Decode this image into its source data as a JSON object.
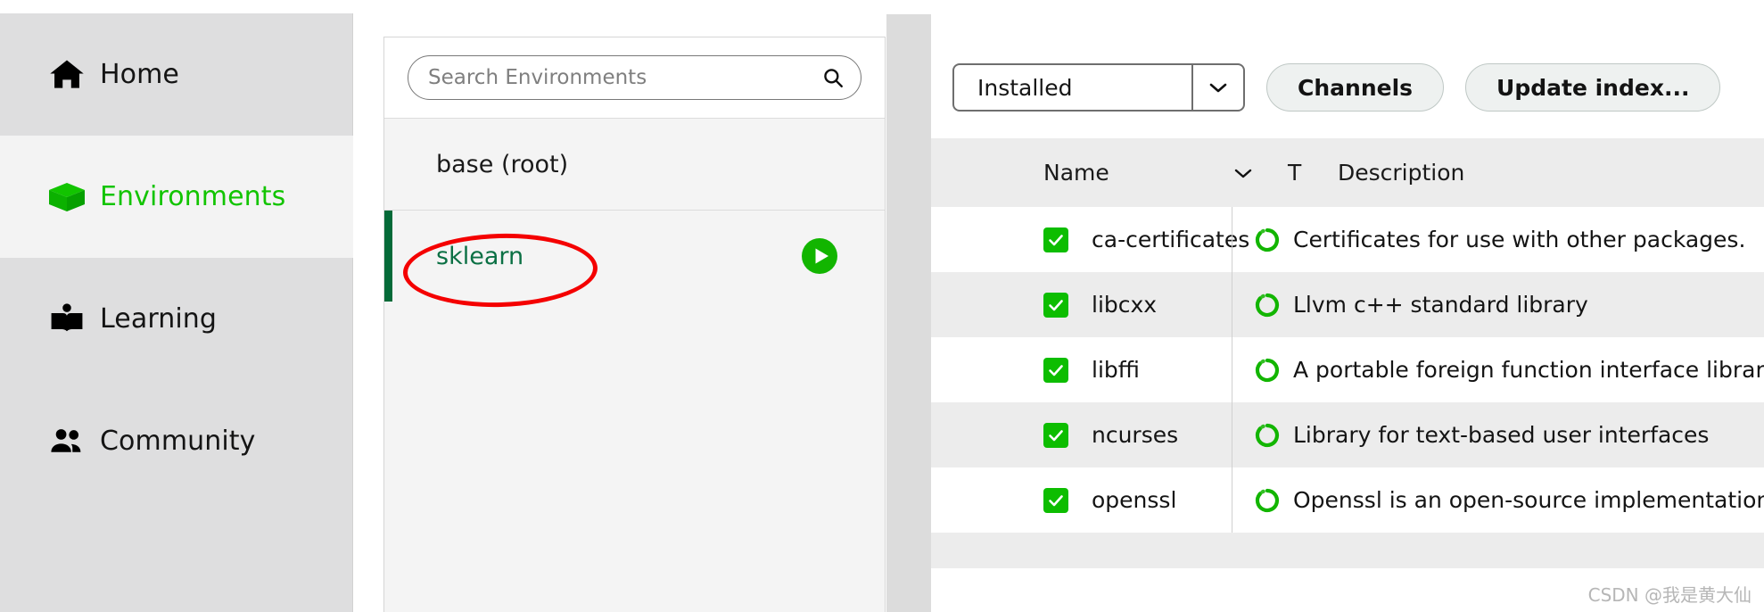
{
  "sidebar": {
    "items": [
      {
        "label": "Home",
        "icon": "home-icon",
        "active": false
      },
      {
        "label": "Environments",
        "icon": "box-icon",
        "active": true
      },
      {
        "label": "Learning",
        "icon": "book-icon",
        "active": false
      },
      {
        "label": "Community",
        "icon": "people-icon",
        "active": false
      }
    ],
    "accent_color": "#12c400",
    "background": "#dededf",
    "active_background": "#f3f3f3"
  },
  "environments": {
    "search": {
      "placeholder": "Search Environments",
      "value": "",
      "icon": "search-icon"
    },
    "rows": [
      {
        "name": "base (root)",
        "selected": false,
        "has_play": false
      },
      {
        "name": "sklearn",
        "selected": true,
        "has_play": true,
        "play_icon": "play-circle-icon"
      }
    ],
    "selected_accent": "#046a38",
    "selected_text_color": "#0b7044"
  },
  "annotation": {
    "type": "ellipse",
    "color": "#f40000",
    "targets": "sklearn"
  },
  "packages": {
    "toolbar": {
      "filter_value": "Installed",
      "filter_icon": "chevron-down-icon",
      "channels_label": "Channels",
      "update_index_label": "Update index..."
    },
    "columns": {
      "name": "Name",
      "sort_icon": "chevron-down-icon",
      "type": "T",
      "description": "Description"
    },
    "rows": [
      {
        "checked": true,
        "name": "ca-certificates",
        "status_icon": "spinner-icon",
        "description": "Certificates for use with other packages."
      },
      {
        "checked": true,
        "name": "libcxx",
        "status_icon": "spinner-icon",
        "description": "Llvm c++ standard library"
      },
      {
        "checked": true,
        "name": "libffi",
        "status_icon": "spinner-icon",
        "description": "A portable foreign function interface library"
      },
      {
        "checked": true,
        "name": "ncurses",
        "status_icon": "spinner-icon",
        "description": "Library for text-based user interfaces"
      },
      {
        "checked": true,
        "name": "openssl",
        "status_icon": "spinner-icon",
        "description": "Openssl is an open-source implementation of the s"
      }
    ],
    "checkbox_color": "#0dbd00",
    "status_color": "#12b500"
  },
  "watermark": {
    "text": "CSDN @我是黄大仙"
  }
}
